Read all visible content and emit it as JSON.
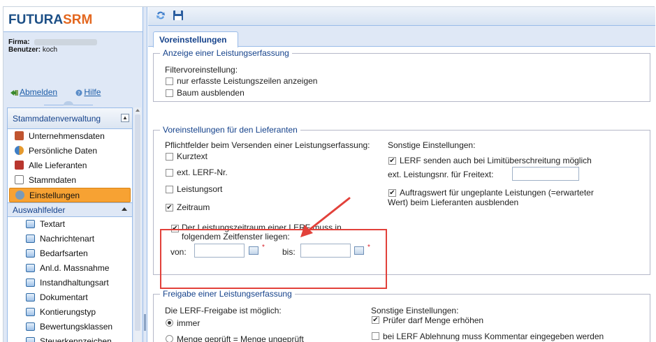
{
  "app": {
    "logo_part1": "FUTURA",
    "logo_part2": "SRM",
    "brand_color": "#1c4f86",
    "accent_color": "#e3671f"
  },
  "user": {
    "firma_label": "Firma:",
    "benutzer_label": "Benutzer:",
    "benutzer_value": "koch",
    "logout_label": "Abmelden",
    "help_label": "Hilfe"
  },
  "nav": {
    "panel_title": "Stammdatenverwaltung",
    "items": [
      {
        "label": "Unternehmensdaten",
        "icon": "company-icon"
      },
      {
        "label": "Persönliche Daten",
        "icon": "people-icon"
      },
      {
        "label": "Alle Lieferanten",
        "icon": "suppliers-icon"
      },
      {
        "label": "Stammdaten",
        "icon": "masterdata-icon"
      },
      {
        "label": "Einstellungen",
        "icon": "settings-icon",
        "selected": true
      }
    ],
    "sub_title": "Auswahlfelder",
    "sub_items": [
      "Textart",
      "Nachrichtenart",
      "Bedarfsarten",
      "Anl.d. Massnahme",
      "Instandhaltungsart",
      "Dokumentart",
      "Kontierungstyp",
      "Bewertungsklassen",
      "Steuerkennzeichen"
    ]
  },
  "toolbar": {
    "refresh_icon": "refresh-icon",
    "save_icon": "save-icon"
  },
  "tab": {
    "label": "Voreinstellungen"
  },
  "group1": {
    "title": "Anzeige einer Leistungserfassung",
    "filter_label": "Filtervoreinstellung:",
    "opt1": "nur erfasste Leistungszeilen anzeigen",
    "opt2": "Baum ausblenden"
  },
  "group2": {
    "title": "Voreinstellungen für den Lieferanten",
    "pflicht_label": "Pflichtfelder beim Versenden einer Leistungserfassung:",
    "kurztext": "Kurztext",
    "extlerf": "ext. LERF-Nr.",
    "leistungsort": "Leistungsort",
    "zeitraum": "Zeitraum",
    "window_line1": "Der Leistungszeitraum einer LERF muss in",
    "window_line2": "folgendem Zeitfenster liegen:",
    "von_label": "von:",
    "bis_label": "bis:",
    "required_mark": "*",
    "sonstige_label": "Sonstige Einstellungen:",
    "lerf_limit": "LERF senden auch bei Limitüberschreitung möglich",
    "ext_leistungsnr": "ext. Leistungsnr. für Freitext:",
    "auftrag_line1": "Auftragswert für ungeplante Leistungen (=erwarteter",
    "auftrag_line2": "Wert) beim Lieferanten ausblenden"
  },
  "group3": {
    "title": "Freigabe einer Leistungserfassung",
    "freigabe_label": "Die LERF-Freigabe ist möglich:",
    "immer": "immer",
    "menge": "Menge geprüft = Menge ungeprüft",
    "sonstige_label": "Sonstige Einstellungen:",
    "pruefer": "Prüfer darf Menge erhöhen",
    "ablehnung": "bei LERF Ablehnung muss Kommentar eingegeben werden"
  },
  "checkmark": "✔",
  "annotation_color": "#e2413a"
}
